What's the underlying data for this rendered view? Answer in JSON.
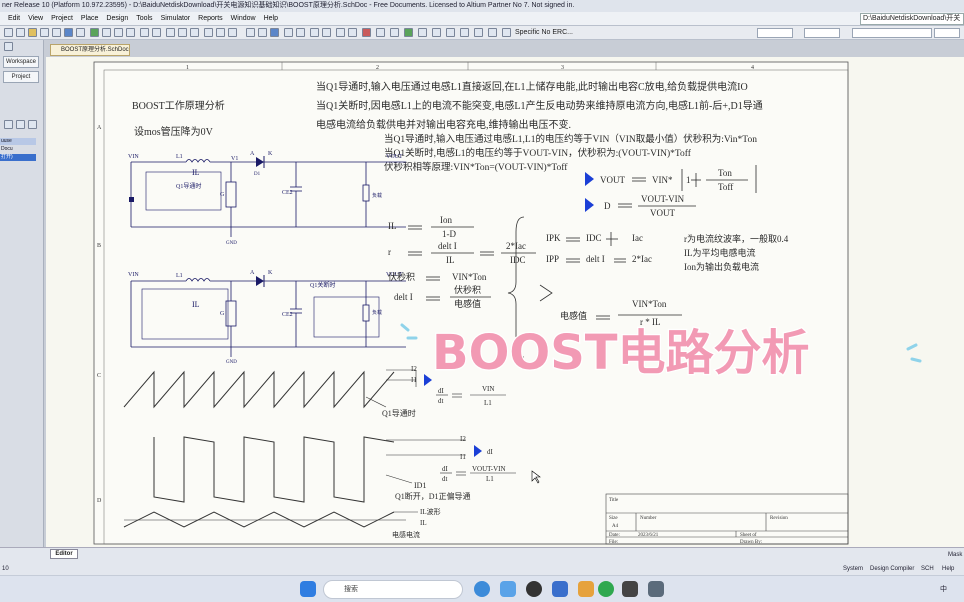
{
  "window": {
    "title": "ner Release 10 (Platform 10.972.23595) - D:\\BaiduNetdiskDownload\\开关电源知识基础知识\\BOOST原理分析.SchDoc - Free Documents. Licensed to Altium Partner No 7. Not signed in."
  },
  "menu": {
    "items": [
      "Edit",
      "View",
      "Project",
      "Place",
      "Design",
      "Tools",
      "Simulator",
      "Reports",
      "Window",
      "Help"
    ],
    "path_right": "D:\\BaiduNetdiskDownload\\开关"
  },
  "toolbar": {
    "specific_label": "Specific No ERC..."
  },
  "sidebar": {
    "tab_workspace": "Workspace",
    "tab_project": "Project",
    "items": [
      "uuse",
      "Docu",
      "打开)"
    ]
  },
  "doc_tab": {
    "label": "BOOST原理分析.SchDoc"
  },
  "schematic": {
    "col_numbers": [
      "1",
      "2",
      "3",
      "4"
    ],
    "row_letters": [
      "A",
      "B",
      "C",
      "D"
    ],
    "heading": "BOOST工作原理分析",
    "assume": "设mos管压降为0V",
    "para1": "当Q1导通时,输入电压通过电感L1直接返回,在L1上储存电能,此时输出电容C放电,给负载提供电流IO",
    "para2": "当Q1关断时,因电感L1上的电流不能突变,电感L1产生反电动势来维持原电流方向,电感L1前-后+,D1导通",
    "para3": "电感电流给负载供电并对输出电容充电,维持输出电压不变.",
    "para4": "当Q1导通时,输入电压通过电感L1,L1的电压约等于VIN（VIN取最小值）伏秒积为:Vin*Ton",
    "para5": "当Q1关断时,电感L1的电压约等于VOUT-VIN，伏秒积为:(VOUT-VIN)*Toff",
    "para6": "伏秒积相等原理:VIN*Ton=(VOUT-VIN)*Toff",
    "circuit_labels": {
      "vin": "VIN",
      "vout": "VOUT",
      "l1": "L1",
      "il": "IL",
      "v1": "V1",
      "a": "A",
      "k": "K",
      "d1": "D1",
      "q1": "Q1",
      "q1_on": "Q1导通时",
      "q1_off": "Q1关断时",
      "g": "G",
      "ce1": "CE1",
      "ce2": "CE2",
      "load": "负载",
      "gnd": "GND"
    },
    "eq": {
      "il_lhs": "IL",
      "il_num": "Ion",
      "il_den": "1-D",
      "r_lhs": "r",
      "r_num": "delt I",
      "r_den": "IL",
      "r_num2": "2*Iac",
      "r_den2": "IDC",
      "fmj_lhs": "伏秒积",
      "fmj_rhs": "VIN*Ton",
      "dI_lhs": "delt I",
      "dI_num": "伏秒积",
      "dI_den": "电感值",
      "vout_lhs": "VOUT",
      "vout_mid": "VIN*",
      "vout_one": "1",
      "vout_num": "Ton",
      "vout_den": "Toff",
      "d_lhs": "D",
      "d_num": "VOUT-VIN",
      "d_den": "VOUT",
      "ipk_lhs": "IPK",
      "ipk_a": "IDC",
      "ipk_b": "Iac",
      "ipp_lhs": "IPP",
      "ipp_a": "delt I",
      "ipp_b": "2*Iac",
      "note1": "r为电流纹波率，一般取0.4",
      "note2": "IL为平均电感电流",
      "note3": "Ion为输出负载电流",
      "ind_lhs": "电感值",
      "ind_num": "VIN*Ton",
      "ind_den": "r * IL"
    },
    "wave": {
      "i2a": "I2",
      "i1a": "I1",
      "dIdt1_num": "dI",
      "dIdt1_den": "dt",
      "vin_l1_num": "VIN",
      "vin_l1_den": "L1",
      "q1_on_lbl": "Q1导通时",
      "i2b": "I2",
      "i1b": "I1",
      "dI": "dI",
      "dIdt2_num": "dI",
      "dIdt2_den": "dt",
      "vv_num": "VOUT-VIN",
      "vv_den": "L1",
      "id1": "ID1",
      "q1_off_lbl": "Q1断开，D1正偏导通",
      "il_wave": "IL波形",
      "il": "IL",
      "ind_current": "电感电流"
    },
    "overlay_title": "BOOST电路分析",
    "titleblock": {
      "title": "Title",
      "size": "Size",
      "size_val": "A4",
      "number": "Number",
      "revision": "Revision",
      "date": "Date:",
      "date_val": "2023/6/21",
      "sheet": "Sheet  of",
      "file": "File:",
      "drawn": "Drawn By:"
    }
  },
  "status": {
    "editor_tab": "Editor",
    "items": [
      "System",
      "Design Compiler",
      "SCH",
      "Help"
    ],
    "left_num": "10",
    "right_mask": "Mask"
  },
  "taskbar": {
    "search_placeholder": "搜索",
    "tray_text": "中"
  },
  "colors": {
    "canvas": "#f7f7f0",
    "schematic_line": "#1a1a66",
    "text": "#2b2b2b",
    "arrow_blue": "#1b3fd6",
    "overlay_pink": "#f29ab4"
  }
}
